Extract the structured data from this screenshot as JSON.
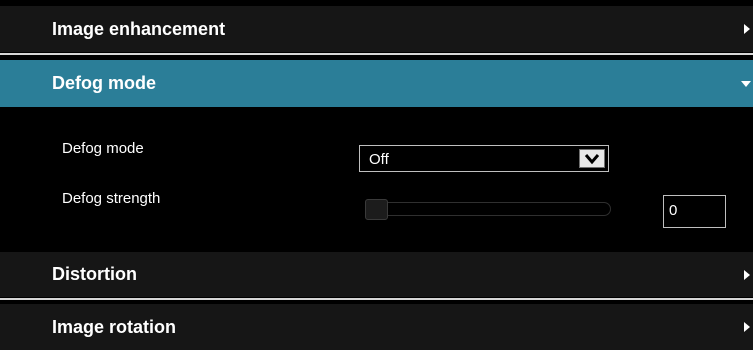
{
  "sections": {
    "image_enhancement": {
      "title": "Image enhancement",
      "expanded": false
    },
    "defog_mode": {
      "title": "Defog mode",
      "expanded": true,
      "color": "#2b7e98",
      "defog_mode_label": "Defog mode",
      "defog_mode_value": "Off",
      "defog_strength_label": "Defog strength",
      "defog_strength_value": "0"
    },
    "distortion": {
      "title": "Distortion",
      "expanded": false
    },
    "image_rotation": {
      "title": "Image rotation",
      "expanded": false
    }
  },
  "icons": {
    "collapsed": "triangle-right-icon",
    "expanded": "triangle-down-icon",
    "dropdown": "chevron-down-icon"
  }
}
